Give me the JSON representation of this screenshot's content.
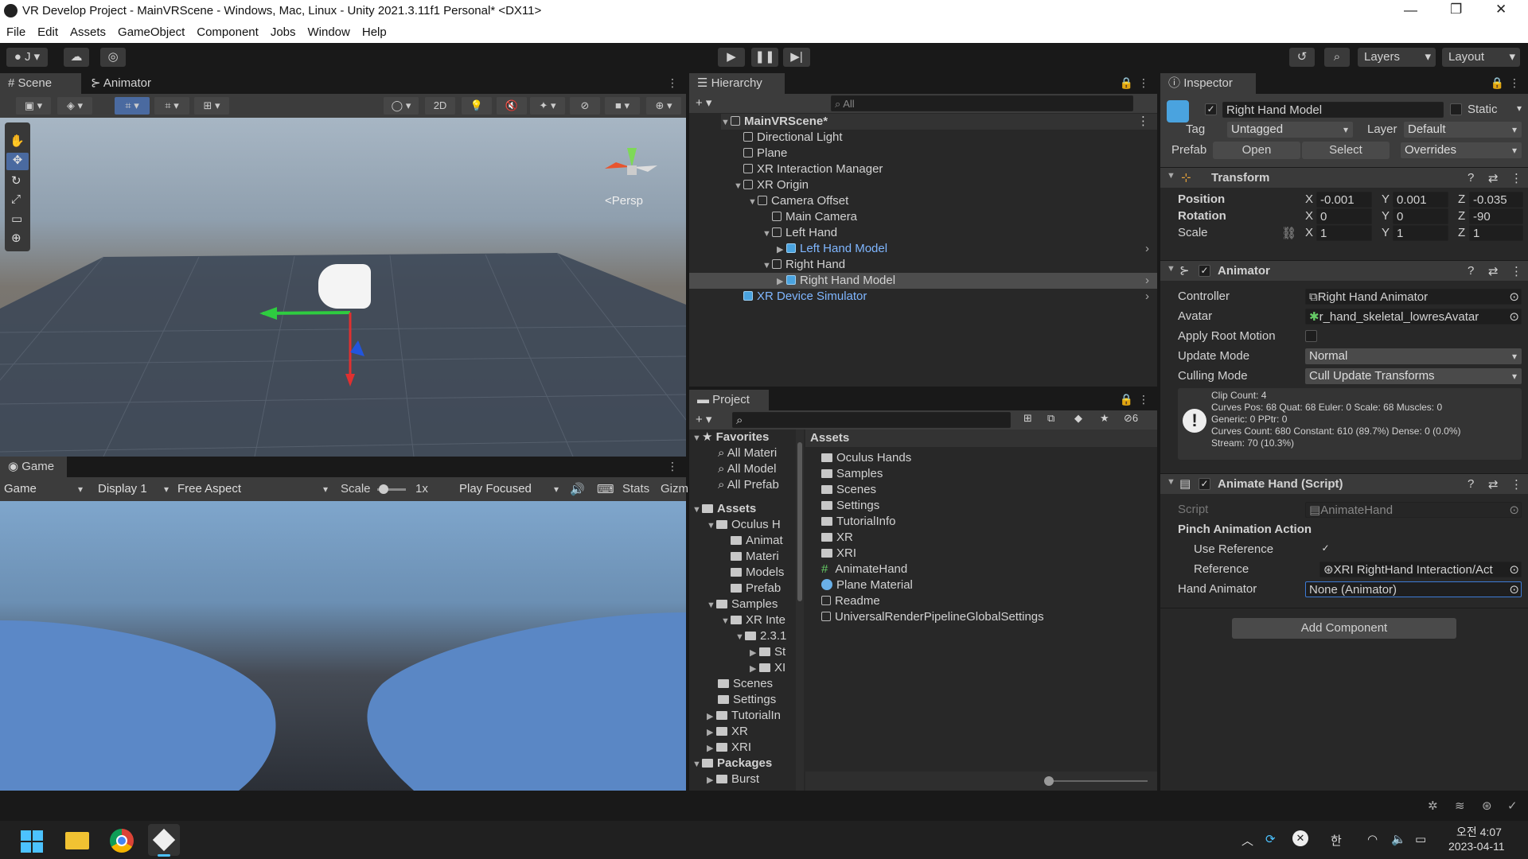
{
  "window": {
    "title": "VR Develop Project - MainVRScene - Windows, Mac, Linux - Unity 2021.3.11f1 Personal* <DX11>"
  },
  "menu": [
    "File",
    "Edit",
    "Assets",
    "GameObject",
    "Component",
    "Jobs",
    "Window",
    "Help"
  ],
  "toolbar": {
    "account": "J",
    "layers": "Layers",
    "layout": "Layout"
  },
  "scene": {
    "tab_scene": "Scene",
    "tab_animator": "Animator",
    "btn_2d": "2D",
    "persp": "Persp"
  },
  "game": {
    "tab": "Game",
    "mode": "Game",
    "display": "Display 1",
    "aspect": "Free Aspect",
    "scale_label": "Scale",
    "scale_val": "1x",
    "play_focused": "Play Focused",
    "stats": "Stats",
    "gizmos": "Gizm"
  },
  "hierarchy": {
    "tab": "Hierarchy",
    "search_placeholder": "All",
    "items": [
      {
        "label": "MainVRScene*"
      },
      {
        "label": "Directional Light"
      },
      {
        "label": "Plane"
      },
      {
        "label": "XR Interaction Manager"
      },
      {
        "label": "XR Origin"
      },
      {
        "label": "Camera Offset"
      },
      {
        "label": "Main Camera"
      },
      {
        "label": "Left Hand"
      },
      {
        "label": "Left Hand Model"
      },
      {
        "label": "Right Hand"
      },
      {
        "label": "Right Hand Model"
      },
      {
        "label": "XR Device Simulator"
      }
    ]
  },
  "project": {
    "tab": "Project",
    "hidden_count": "6",
    "assets_header": "Assets",
    "tree": [
      "Favorites",
      "All Materi",
      "All Model",
      "All Prefab",
      "Assets",
      "Oculus H",
      "Animat",
      "Materi",
      "Models",
      "Prefab",
      "Samples",
      "XR Inte",
      "2.3.1",
      "St",
      "XI",
      "Scenes",
      "Settings",
      "TutorialIn",
      "XR",
      "XRI",
      "Packages",
      "Burst"
    ],
    "assets": [
      "Oculus Hands",
      "Samples",
      "Scenes",
      "Settings",
      "TutorialInfo",
      "XR",
      "XRI",
      "AnimateHand",
      "Plane Material",
      "Readme",
      "UniversalRenderPipelineGlobalSettings"
    ]
  },
  "inspector": {
    "tab": "Inspector",
    "object_name": "Right Hand Model",
    "static": "Static",
    "tag_label": "Tag",
    "tag": "Untagged",
    "layer_label": "Layer",
    "layer": "Default",
    "prefab_label": "Prefab",
    "open": "Open",
    "select": "Select",
    "overrides": "Overrides",
    "transform": {
      "title": "Transform",
      "position": "Position",
      "rotation": "Rotation",
      "scale": "Scale",
      "pos": [
        "-0.001",
        "0.001",
        "-0.035"
      ],
      "rot": [
        "0",
        "0",
        "-90"
      ],
      "scl": [
        "1",
        "1",
        "1"
      ]
    },
    "axes": [
      "X",
      "Y",
      "Z"
    ],
    "animator": {
      "title": "Animator",
      "controller_label": "Controller",
      "controller": "Right Hand Animator",
      "avatar_label": "Avatar",
      "avatar": "r_hand_skeletal_lowresAvatar",
      "root_motion": "Apply Root Motion",
      "update_label": "Update Mode",
      "update": "Normal",
      "culling_label": "Culling Mode",
      "culling": "Cull Update Transforms",
      "info": [
        "Clip Count: 4",
        "Curves Pos: 68 Quat: 68 Euler: 0 Scale: 68 Muscles: 0",
        "Generic: 0 PPtr: 0",
        "Curves Count: 680 Constant: 610 (89.7%) Dense: 0 (0.0%)",
        "Stream: 70 (10.3%)"
      ]
    },
    "script": {
      "title": "Animate Hand (Script)",
      "script_label": "Script",
      "script": "AnimateHand",
      "pinch": "Pinch Animation Action",
      "use_ref": "Use Reference",
      "ref_label": "Reference",
      "ref": "XRI RightHand Interaction/Act",
      "hand_anim_label": "Hand Animator",
      "hand_anim": "None (Animator)"
    },
    "add_component": "Add Component"
  },
  "taskbar": {
    "ampm": "오전 4:07",
    "date": "2023-04-11",
    "ime": "한"
  }
}
